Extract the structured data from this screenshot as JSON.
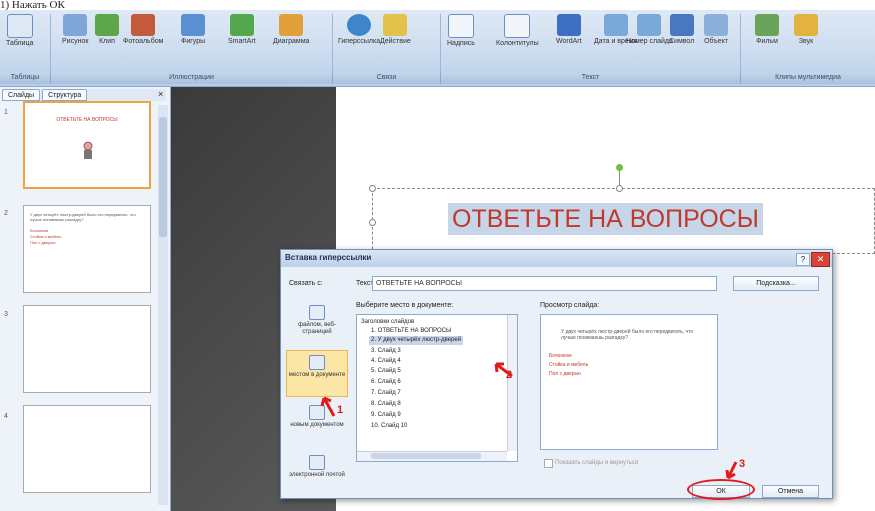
{
  "caption": "1) Нажать ОК",
  "ribbon": {
    "buttons": [
      {
        "label": "Таблица",
        "icon": "table-icon"
      },
      {
        "label": "Рисунок",
        "icon": "picture-icon"
      },
      {
        "label": "Клип",
        "icon": "clip-icon"
      },
      {
        "label": "Фотоальбом",
        "icon": "photo-album-icon"
      },
      {
        "label": "Фигуры",
        "icon": "shapes-icon"
      },
      {
        "label": "SmartArt",
        "icon": "smartart-icon"
      },
      {
        "label": "Диаграмма",
        "icon": "chart-icon"
      },
      {
        "label": "Гиперссылка",
        "icon": "hyperlink-icon"
      },
      {
        "label": "Действие",
        "icon": "action-icon"
      },
      {
        "label": "Надпись",
        "icon": "textbox-icon"
      },
      {
        "label": "Колонтитулы",
        "icon": "header-footer-icon"
      },
      {
        "label": "WordArt",
        "icon": "wordart-icon"
      },
      {
        "label": "Дата и время",
        "icon": "date-time-icon"
      },
      {
        "label": "Номер слайда",
        "icon": "slide-number-icon"
      },
      {
        "label": "Символ",
        "icon": "symbol-icon"
      },
      {
        "label": "Объект",
        "icon": "object-icon"
      },
      {
        "label": "Фильм",
        "icon": "movie-icon"
      },
      {
        "label": "Звук",
        "icon": "sound-icon"
      }
    ],
    "groups": [
      "Таблицы",
      "Иллюстрации",
      "Связи",
      "Текст",
      "Клипы мультимедиа"
    ]
  },
  "left_panel": {
    "tabs": [
      "Слайды",
      "Структура"
    ],
    "close": "×",
    "slides": [
      {
        "num": "1",
        "title": "ОТВЕТЬТЕ НА ВОПРОСЫ"
      },
      {
        "num": "2",
        "text": "У двух четырёх люстр-дверей было его передвигать, что лучше понимаешь разгадку?",
        "bullets": [
          "Бочонком",
          "Стойка и мебель",
          "Пол с дверью"
        ]
      },
      {
        "num": "3"
      },
      {
        "num": "4"
      }
    ]
  },
  "slide": {
    "title": "ОТВЕТЬТЕ НА ВОПРОСЫ"
  },
  "dialog": {
    "title": "Вставка гиперссылки",
    "help": "?",
    "close": "✕",
    "link_to_label": "Связать с:",
    "text_label": "Текст:",
    "text_value": "ОТВЕТЬТЕ НА ВОПРОСЫ",
    "tooltip_button": "Подсказка...",
    "link_targets": [
      "файлом, веб-страницей",
      "местом в документе",
      "новым документом",
      "электронной почтой"
    ],
    "select_place_label": "Выберите место в документе:",
    "tree": [
      "Заголовки слайдов",
      "1. ОТВЕТЬТЕ НА ВОПРОСЫ",
      "2. У двух четырёх люстр-дверей",
      "3. Слайд 3",
      "4. Слайд 4",
      "5. Слайд 5",
      "6. Слайд 6",
      "7. Слайд 7",
      "8. Слайд 8",
      "9. Слайд 9",
      "10. Слайд 10"
    ],
    "preview_label": "Просмотр слайда:",
    "preview_text": "У двух четырёх люстр-дверей было его передвигать, что лучше понимаешь разгадку?",
    "preview_bullets": [
      "Бочонком",
      "Стойка и мебель",
      "Пол с дверью"
    ],
    "show_target": "Показать слайды и вернуться",
    "ok": "ОК",
    "cancel": "Отмена"
  },
  "markers": [
    "1",
    "2",
    "3"
  ]
}
